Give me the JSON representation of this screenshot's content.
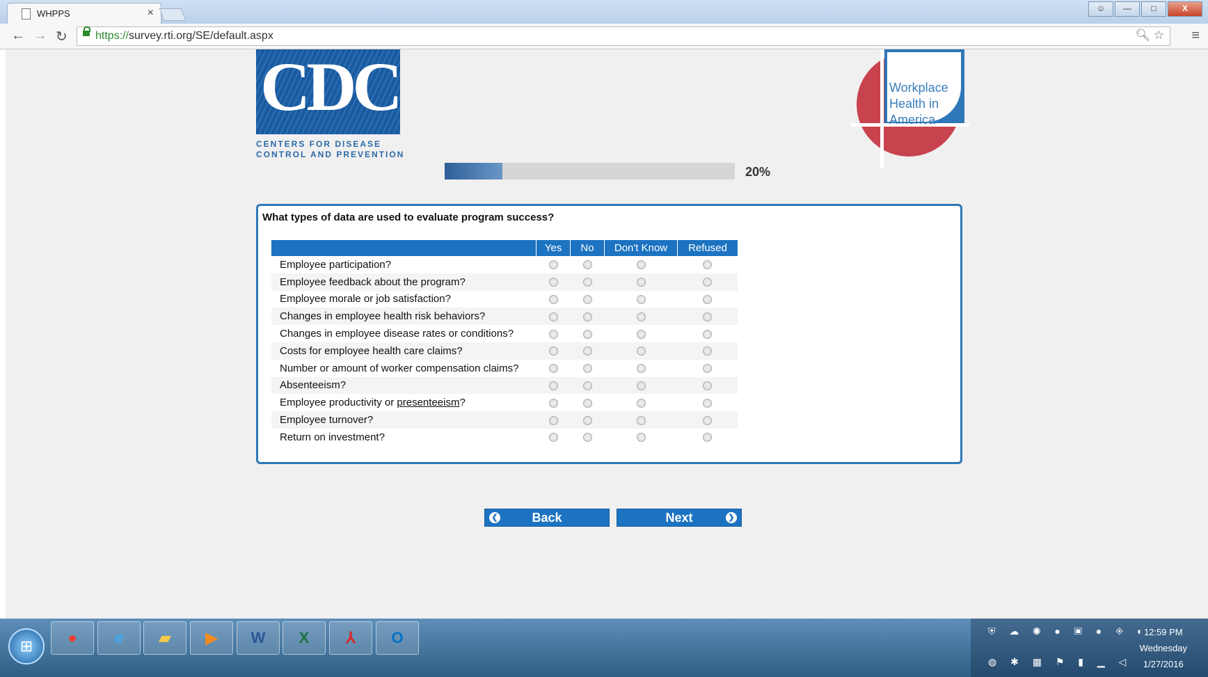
{
  "browser": {
    "tab_title": "WHPPS",
    "tab_close": "×",
    "url_scheme": "https://",
    "url_rest": "survey.rti.org/SE/default.aspx",
    "window_buttons": {
      "minimize": "—",
      "maximize": "□",
      "close": "X"
    }
  },
  "header": {
    "cdc_letters": "CDC",
    "cdc_tagline_1": "CENTERS FOR DISEASE",
    "cdc_tagline_2": "CONTROL AND PREVENTION",
    "whia_text": "Workplace Health in America"
  },
  "progress": {
    "percent": 20,
    "label": "20%"
  },
  "survey": {
    "question": "What types of data are used to evaluate program success?",
    "columns": [
      "Yes",
      "No",
      "Don't Know",
      "Refused"
    ],
    "items": [
      "Employee participation?",
      "Employee feedback about the program?",
      "Employee morale or job satisfaction?",
      "Changes in employee health risk behaviors?",
      "Changes in employee disease rates or conditions?",
      "Costs for employee health care claims?",
      "Number or amount of worker compensation claims?",
      "Absenteeism?",
      "Employee productivity or ",
      "Employee turnover?",
      "Return on investment?"
    ],
    "link_term": "presenteeism",
    "link_suffix": "?"
  },
  "nav": {
    "back_label": "Back",
    "next_label": "Next"
  },
  "taskbar": {
    "apps": [
      "chrome",
      "internet-explorer",
      "file-explorer",
      "media-player",
      "word",
      "excel",
      "acrobat",
      "outlook"
    ],
    "time": "12:59 PM",
    "day": "Wednesday",
    "date": "1/27/2016"
  }
}
